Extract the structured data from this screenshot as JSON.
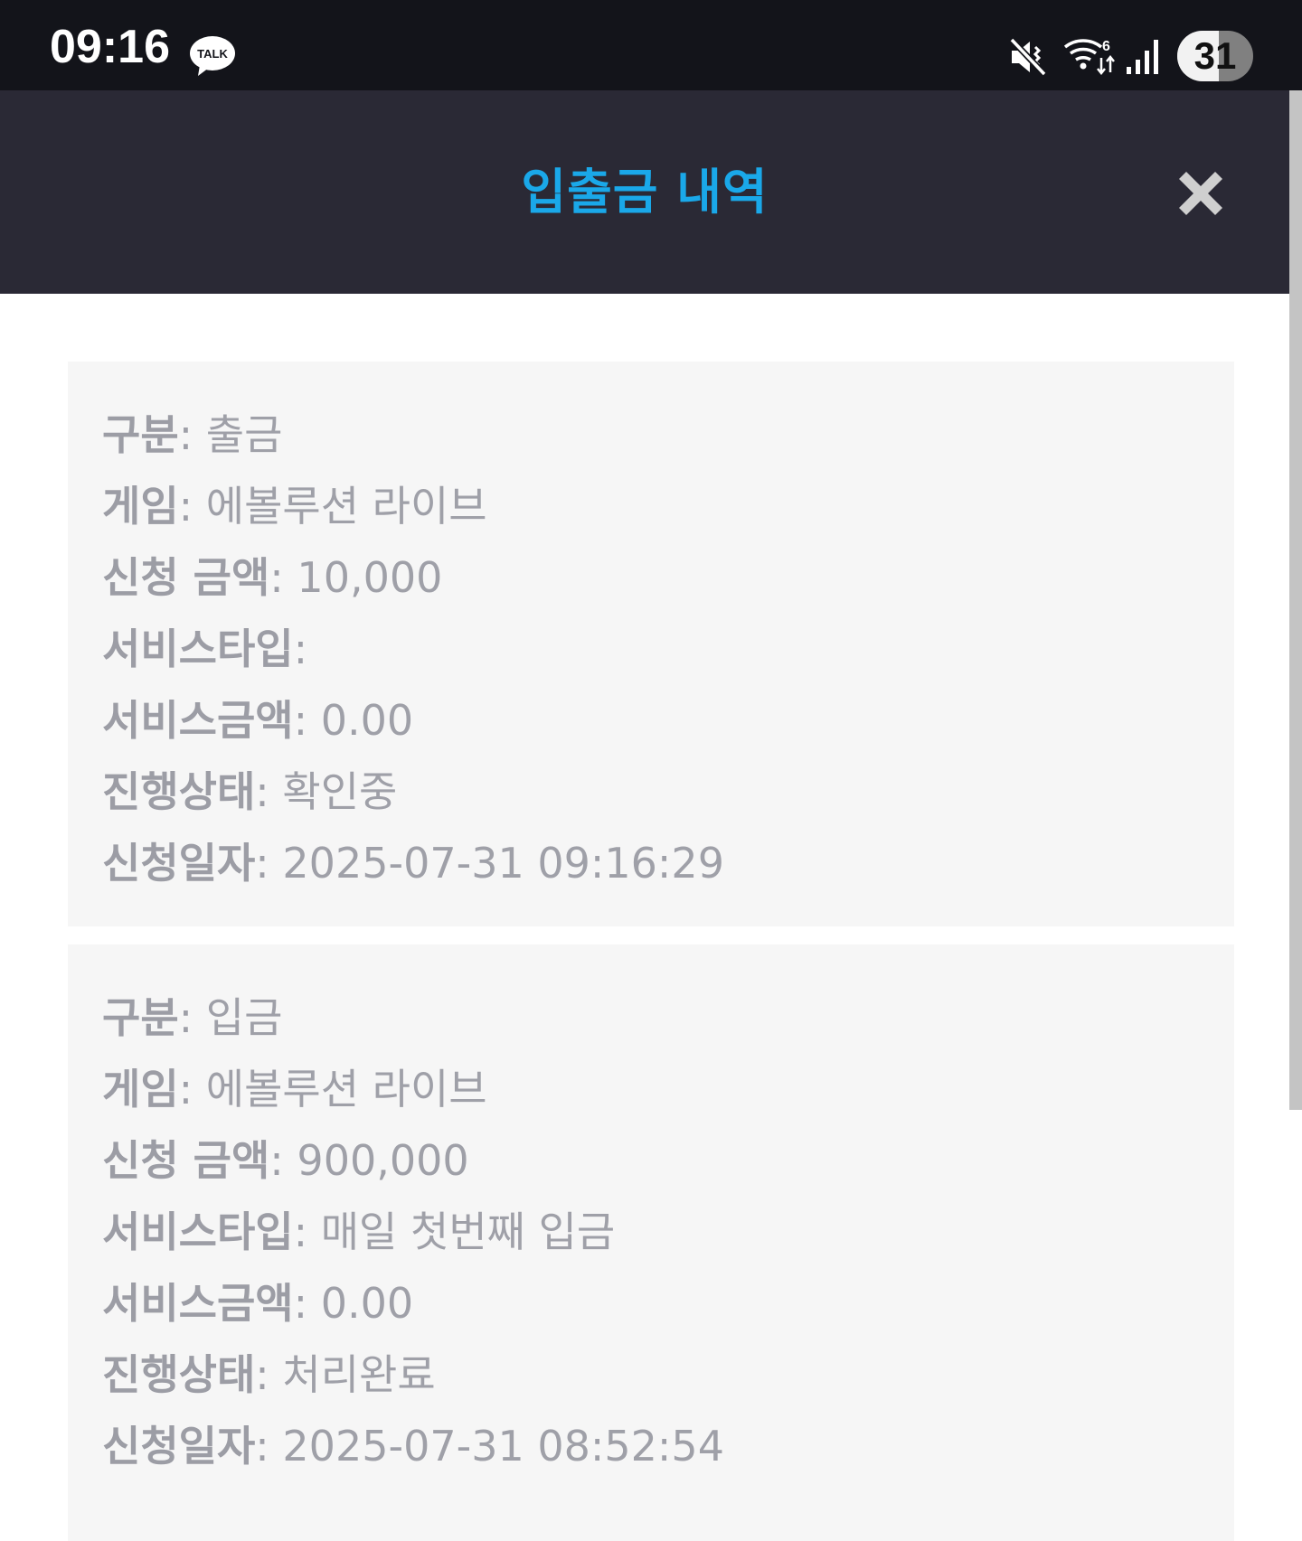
{
  "status_bar": {
    "time": "09:16",
    "talk_badge": "TALK",
    "battery_level": "31",
    "icons": [
      "kakaotalk-icon",
      "mute-vibrate-icon",
      "wifi-icon",
      "cellular-signal-icon",
      "battery-icon"
    ]
  },
  "header": {
    "title": "입출금 내역",
    "close_icon": "close-icon"
  },
  "colors": {
    "status_bar_bg": "#13141a",
    "header_bg": "#2a2935",
    "title_accent": "#1aa8e9",
    "card_bg": "#f6f6f6",
    "text_gray": "#9fa0a8"
  },
  "records": [
    {
      "rows": [
        {
          "label": "구분",
          "value": "출금"
        },
        {
          "label": "게임",
          "value": "에볼루션 라이브"
        },
        {
          "label": "신청 금액",
          "value": "10,000"
        },
        {
          "label": "서비스타입",
          "value": ""
        },
        {
          "label": "서비스금액",
          "value": "0.00"
        },
        {
          "label": "진행상태",
          "value": "확인중"
        },
        {
          "label": "신청일자",
          "value": "2025-07-31 09:16:29"
        }
      ]
    },
    {
      "rows": [
        {
          "label": "구분",
          "value": "입금"
        },
        {
          "label": "게임",
          "value": "에볼루션 라이브"
        },
        {
          "label": "신청 금액",
          "value": "900,000"
        },
        {
          "label": "서비스타입",
          "value": "매일 첫번째 입금"
        },
        {
          "label": "서비스금액",
          "value": "0.00"
        },
        {
          "label": "진행상태",
          "value": "처리완료"
        },
        {
          "label": "신청일자",
          "value": "2025-07-31 08:52:54"
        }
      ]
    }
  ]
}
